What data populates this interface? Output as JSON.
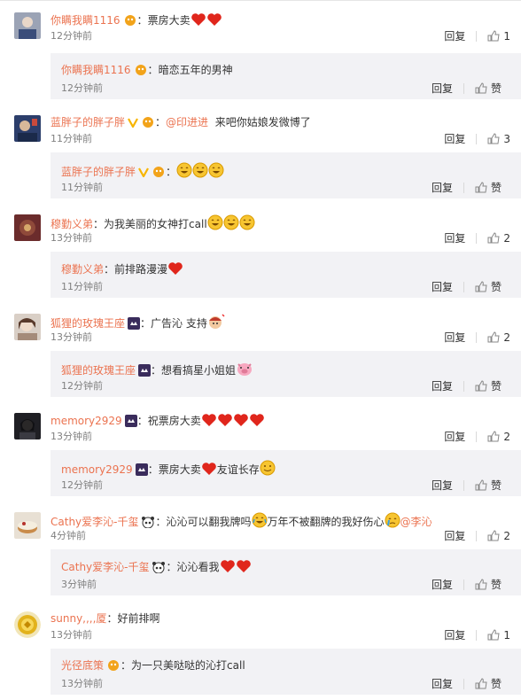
{
  "like_word": "赞",
  "reply_word": "回复",
  "comments": [
    {
      "user": "你瞒我瞒1116",
      "text": "票房大卖",
      "time": "12分钟前",
      "reply_label": "回复",
      "likes": "1",
      "reply": {
        "user": "你瞒我瞒1116",
        "text": "暗恋五年的男神",
        "time": "12分钟前",
        "reply_label": "回复",
        "like_label": "赞"
      }
    },
    {
      "user": "蓝胖子的胖子胖",
      "mention": "@印进进",
      "text": "来吧你姑娘发微博了",
      "time": "11分钟前",
      "reply_label": "回复",
      "likes": "3",
      "reply": {
        "user": "蓝胖子的胖子胖",
        "text": "",
        "time": "11分钟前",
        "reply_label": "回复",
        "like_label": "赞"
      }
    },
    {
      "user": "穆勤义弟",
      "text": "为我美丽的女神打call",
      "time": "13分钟前",
      "reply_label": "回复",
      "likes": "2",
      "reply": {
        "user": "穆勤义弟",
        "text": "前排路漫漫",
        "time": "11分钟前",
        "reply_label": "回复",
        "like_label": "赞"
      }
    },
    {
      "user": "狐狸的玫瑰王座",
      "text": "广告沁 支持",
      "time": "13分钟前",
      "reply_label": "回复",
      "likes": "2",
      "reply": {
        "user": "狐狸的玫瑰王座",
        "text": "想看搞星小姐姐",
        "time": "12分钟前",
        "reply_label": "回复",
        "like_label": "赞"
      }
    },
    {
      "user": "memory2929",
      "text": "祝票房大卖",
      "time": "13分钟前",
      "reply_label": "回复",
      "likes": "2",
      "reply": {
        "user": "memory2929",
        "text": "票房大卖",
        "text2": "友谊长存",
        "time": "12分钟前",
        "reply_label": "回复",
        "like_label": "赞"
      }
    },
    {
      "user": "Cathy爱李沁-千玺",
      "text": "沁沁可以翻我牌吗",
      "text2": "万年不被翻牌的我好伤心",
      "mention": "@李沁",
      "time": "4分钟前",
      "reply_label": "回复",
      "likes": "2",
      "reply": {
        "user": "Cathy爱李沁-千玺",
        "text": "沁沁看我",
        "time": "3分钟前",
        "reply_label": "回复",
        "like_label": "赞"
      }
    },
    {
      "user": "sunny,,,,厦",
      "text": "好前排啊",
      "time": "13分钟前",
      "reply_label": "回复",
      "likes": "1",
      "reply": {
        "user": "光径底策",
        "text": "为一只美哒哒的沁打call",
        "time": "13分钟前",
        "reply_label": "回复",
        "like_label": "赞"
      }
    }
  ],
  "colors": {
    "username": "#eb7350",
    "time": "#808080",
    "reply_bg": "#f2f2f5"
  }
}
